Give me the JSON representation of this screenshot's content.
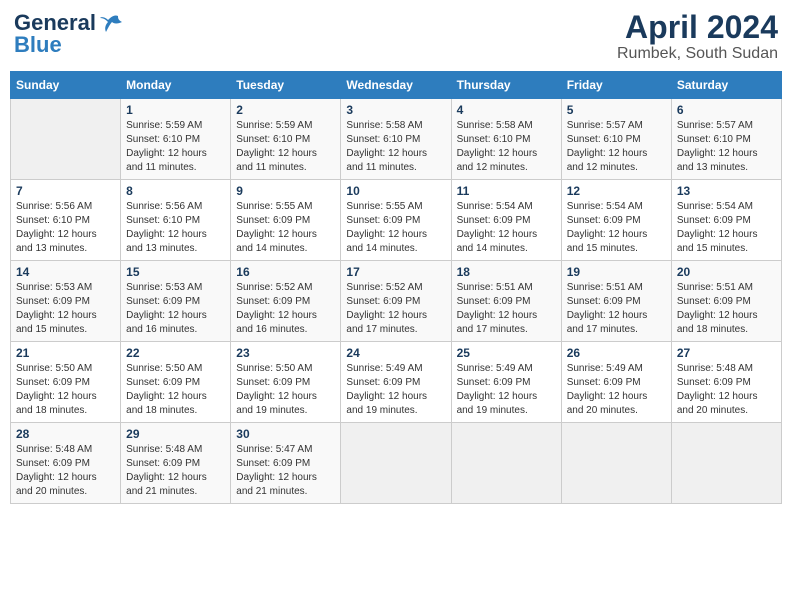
{
  "header": {
    "logo_line1": "General",
    "logo_line2": "Blue",
    "month_title": "April 2024",
    "subtitle": "Rumbek, South Sudan"
  },
  "days_of_week": [
    "Sunday",
    "Monday",
    "Tuesday",
    "Wednesday",
    "Thursday",
    "Friday",
    "Saturday"
  ],
  "weeks": [
    [
      {
        "day": "",
        "sunrise": "",
        "sunset": "",
        "daylight": "",
        "empty": true
      },
      {
        "day": "1",
        "sunrise": "Sunrise: 5:59 AM",
        "sunset": "Sunset: 6:10 PM",
        "daylight": "Daylight: 12 hours and 11 minutes."
      },
      {
        "day": "2",
        "sunrise": "Sunrise: 5:59 AM",
        "sunset": "Sunset: 6:10 PM",
        "daylight": "Daylight: 12 hours and 11 minutes."
      },
      {
        "day": "3",
        "sunrise": "Sunrise: 5:58 AM",
        "sunset": "Sunset: 6:10 PM",
        "daylight": "Daylight: 12 hours and 11 minutes."
      },
      {
        "day": "4",
        "sunrise": "Sunrise: 5:58 AM",
        "sunset": "Sunset: 6:10 PM",
        "daylight": "Daylight: 12 hours and 12 minutes."
      },
      {
        "day": "5",
        "sunrise": "Sunrise: 5:57 AM",
        "sunset": "Sunset: 6:10 PM",
        "daylight": "Daylight: 12 hours and 12 minutes."
      },
      {
        "day": "6",
        "sunrise": "Sunrise: 5:57 AM",
        "sunset": "Sunset: 6:10 PM",
        "daylight": "Daylight: 12 hours and 13 minutes."
      }
    ],
    [
      {
        "day": "7",
        "sunrise": "Sunrise: 5:56 AM",
        "sunset": "Sunset: 6:10 PM",
        "daylight": "Daylight: 12 hours and 13 minutes."
      },
      {
        "day": "8",
        "sunrise": "Sunrise: 5:56 AM",
        "sunset": "Sunset: 6:10 PM",
        "daylight": "Daylight: 12 hours and 13 minutes."
      },
      {
        "day": "9",
        "sunrise": "Sunrise: 5:55 AM",
        "sunset": "Sunset: 6:09 PM",
        "daylight": "Daylight: 12 hours and 14 minutes."
      },
      {
        "day": "10",
        "sunrise": "Sunrise: 5:55 AM",
        "sunset": "Sunset: 6:09 PM",
        "daylight": "Daylight: 12 hours and 14 minutes."
      },
      {
        "day": "11",
        "sunrise": "Sunrise: 5:54 AM",
        "sunset": "Sunset: 6:09 PM",
        "daylight": "Daylight: 12 hours and 14 minutes."
      },
      {
        "day": "12",
        "sunrise": "Sunrise: 5:54 AM",
        "sunset": "Sunset: 6:09 PM",
        "daylight": "Daylight: 12 hours and 15 minutes."
      },
      {
        "day": "13",
        "sunrise": "Sunrise: 5:54 AM",
        "sunset": "Sunset: 6:09 PM",
        "daylight": "Daylight: 12 hours and 15 minutes."
      }
    ],
    [
      {
        "day": "14",
        "sunrise": "Sunrise: 5:53 AM",
        "sunset": "Sunset: 6:09 PM",
        "daylight": "Daylight: 12 hours and 15 minutes."
      },
      {
        "day": "15",
        "sunrise": "Sunrise: 5:53 AM",
        "sunset": "Sunset: 6:09 PM",
        "daylight": "Daylight: 12 hours and 16 minutes."
      },
      {
        "day": "16",
        "sunrise": "Sunrise: 5:52 AM",
        "sunset": "Sunset: 6:09 PM",
        "daylight": "Daylight: 12 hours and 16 minutes."
      },
      {
        "day": "17",
        "sunrise": "Sunrise: 5:52 AM",
        "sunset": "Sunset: 6:09 PM",
        "daylight": "Daylight: 12 hours and 17 minutes."
      },
      {
        "day": "18",
        "sunrise": "Sunrise: 5:51 AM",
        "sunset": "Sunset: 6:09 PM",
        "daylight": "Daylight: 12 hours and 17 minutes."
      },
      {
        "day": "19",
        "sunrise": "Sunrise: 5:51 AM",
        "sunset": "Sunset: 6:09 PM",
        "daylight": "Daylight: 12 hours and 17 minutes."
      },
      {
        "day": "20",
        "sunrise": "Sunrise: 5:51 AM",
        "sunset": "Sunset: 6:09 PM",
        "daylight": "Daylight: 12 hours and 18 minutes."
      }
    ],
    [
      {
        "day": "21",
        "sunrise": "Sunrise: 5:50 AM",
        "sunset": "Sunset: 6:09 PM",
        "daylight": "Daylight: 12 hours and 18 minutes."
      },
      {
        "day": "22",
        "sunrise": "Sunrise: 5:50 AM",
        "sunset": "Sunset: 6:09 PM",
        "daylight": "Daylight: 12 hours and 18 minutes."
      },
      {
        "day": "23",
        "sunrise": "Sunrise: 5:50 AM",
        "sunset": "Sunset: 6:09 PM",
        "daylight": "Daylight: 12 hours and 19 minutes."
      },
      {
        "day": "24",
        "sunrise": "Sunrise: 5:49 AM",
        "sunset": "Sunset: 6:09 PM",
        "daylight": "Daylight: 12 hours and 19 minutes."
      },
      {
        "day": "25",
        "sunrise": "Sunrise: 5:49 AM",
        "sunset": "Sunset: 6:09 PM",
        "daylight": "Daylight: 12 hours and 19 minutes."
      },
      {
        "day": "26",
        "sunrise": "Sunrise: 5:49 AM",
        "sunset": "Sunset: 6:09 PM",
        "daylight": "Daylight: 12 hours and 20 minutes."
      },
      {
        "day": "27",
        "sunrise": "Sunrise: 5:48 AM",
        "sunset": "Sunset: 6:09 PM",
        "daylight": "Daylight: 12 hours and 20 minutes."
      }
    ],
    [
      {
        "day": "28",
        "sunrise": "Sunrise: 5:48 AM",
        "sunset": "Sunset: 6:09 PM",
        "daylight": "Daylight: 12 hours and 20 minutes."
      },
      {
        "day": "29",
        "sunrise": "Sunrise: 5:48 AM",
        "sunset": "Sunset: 6:09 PM",
        "daylight": "Daylight: 12 hours and 21 minutes."
      },
      {
        "day": "30",
        "sunrise": "Sunrise: 5:47 AM",
        "sunset": "Sunset: 6:09 PM",
        "daylight": "Daylight: 12 hours and 21 minutes."
      },
      {
        "day": "",
        "sunrise": "",
        "sunset": "",
        "daylight": "",
        "empty": true
      },
      {
        "day": "",
        "sunrise": "",
        "sunset": "",
        "daylight": "",
        "empty": true
      },
      {
        "day": "",
        "sunrise": "",
        "sunset": "",
        "daylight": "",
        "empty": true
      },
      {
        "day": "",
        "sunrise": "",
        "sunset": "",
        "daylight": "",
        "empty": true
      }
    ]
  ]
}
